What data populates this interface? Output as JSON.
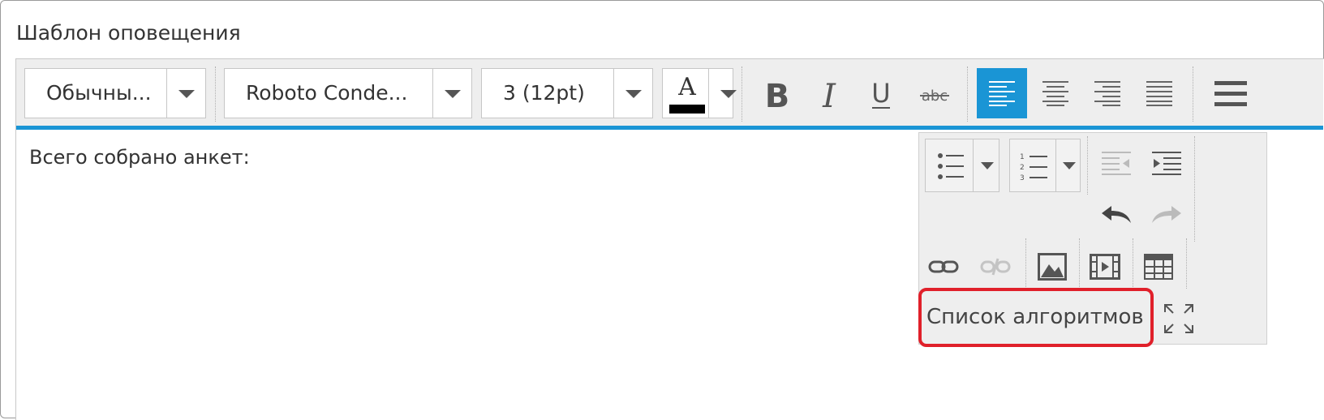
{
  "panel": {
    "title": "Шаблон оповещения"
  },
  "toolbar": {
    "format_value": "Обычны...",
    "font_value": "Roboto Conde...",
    "size_value": "3 (12pt)",
    "font_color": "#000000",
    "accent_color": "#1a95d5",
    "active_align": "left"
  },
  "editor": {
    "content": "Всего собрано анкет:"
  },
  "overflow_menu": {
    "algorithms_button": "Список алгоритмов",
    "highlight_color": "#e0202a"
  },
  "icons": [
    "bold-icon",
    "italic-icon",
    "underline-icon",
    "strikethrough-icon",
    "align-left-icon",
    "align-center-icon",
    "align-right-icon",
    "align-justify-icon",
    "hamburger-menu-icon",
    "bullet-list-icon",
    "numbered-list-icon",
    "outdent-icon",
    "indent-icon",
    "undo-icon",
    "redo-icon",
    "link-icon",
    "unlink-icon",
    "image-icon",
    "video-icon",
    "table-icon",
    "fullscreen-icon"
  ]
}
